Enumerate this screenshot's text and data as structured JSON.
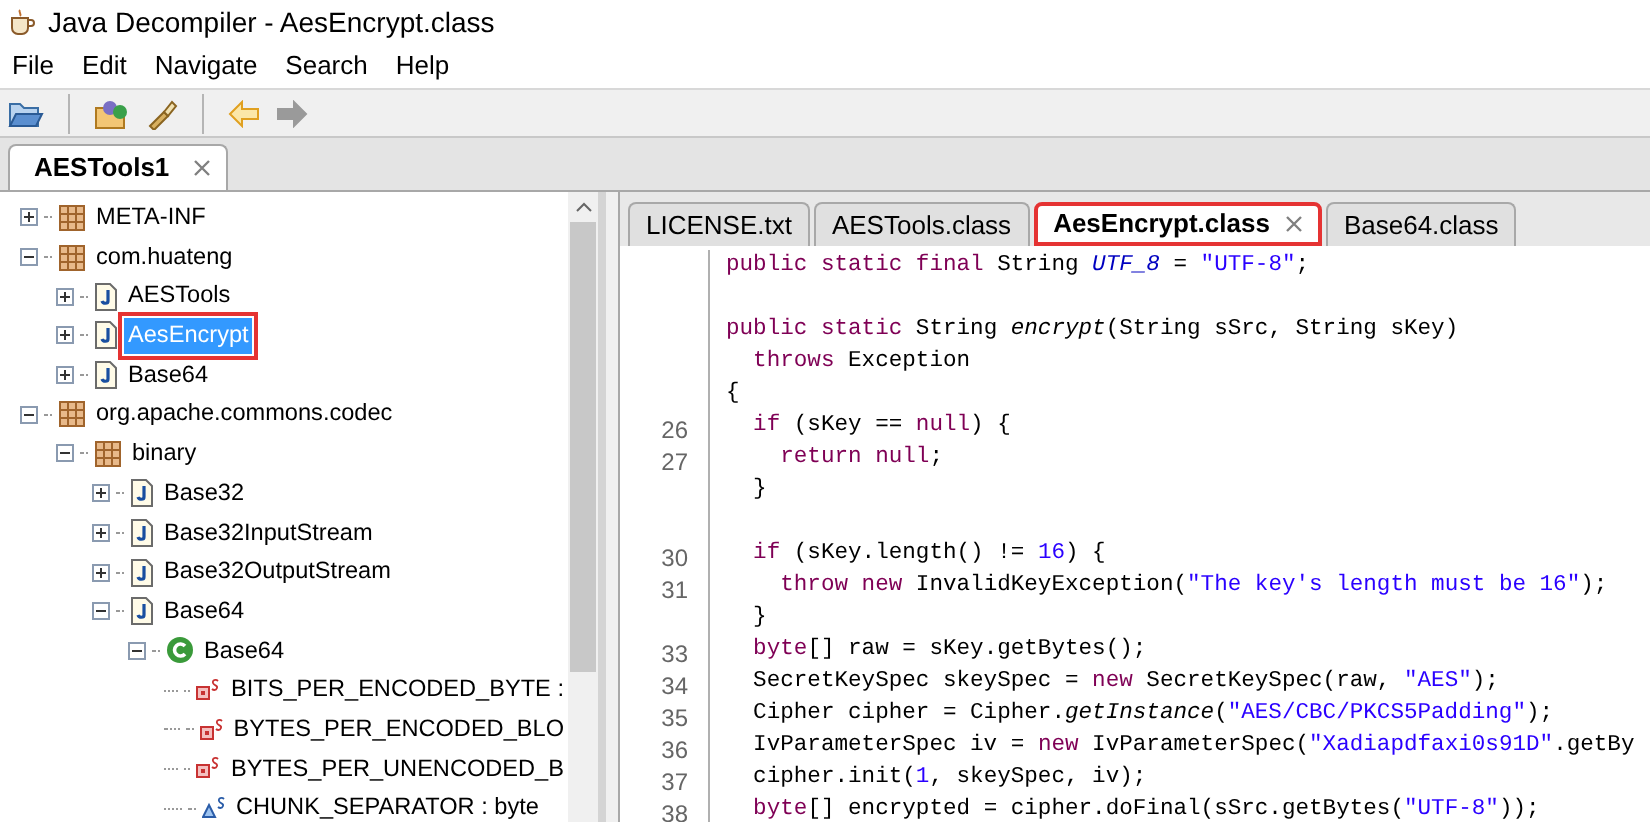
{
  "window": {
    "title": "Java Decompiler - AesEncrypt.class"
  },
  "menu": [
    "File",
    "Edit",
    "Navigate",
    "Search",
    "Help"
  ],
  "toolbar": [
    {
      "kind": "open-file",
      "disabled": false
    },
    {
      "kind": "separator"
    },
    {
      "kind": "open-type",
      "disabled": false
    },
    {
      "kind": "search",
      "disabled": false
    },
    {
      "kind": "separator"
    },
    {
      "kind": "back",
      "disabled": false
    },
    {
      "kind": "forward",
      "disabled": true
    }
  ],
  "file_tabs": [
    {
      "label": "AESTools1",
      "selected": true
    }
  ],
  "tree": [
    {
      "label": "META-INF",
      "kind": "package",
      "expanded": false,
      "selected": false
    },
    {
      "label": "com.huateng",
      "kind": "package",
      "expanded": true,
      "selected": false,
      "children": [
        {
          "label": "AESTools",
          "kind": "class-file",
          "expanded": false,
          "selected": false
        },
        {
          "label": "AesEncrypt",
          "kind": "class-file",
          "expanded": false,
          "selected": true
        },
        {
          "label": "Base64",
          "kind": "class-file",
          "expanded": false,
          "selected": false
        }
      ]
    },
    {
      "label": "org.apache.commons.codec",
      "kind": "package",
      "expanded": true,
      "selected": false,
      "children": [
        {
          "label": "binary",
          "kind": "package",
          "expanded": true,
          "selected": false,
          "children": [
            {
              "label": "Base32",
              "kind": "class-file",
              "expanded": false,
              "selected": false
            },
            {
              "label": "Base32InputStream",
              "kind": "class-file",
              "expanded": false,
              "selected": false
            },
            {
              "label": "Base32OutputStream",
              "kind": "class-file",
              "expanded": false,
              "selected": false
            },
            {
              "label": "Base64",
              "kind": "class-file",
              "expanded": true,
              "selected": false,
              "children": [
                {
                  "label": "Base64",
                  "kind": "class",
                  "expanded": true,
                  "selected": false,
                  "children": [
                    {
                      "label": "BITS_PER_ENCODED_BYTE :",
                      "kind": "private-static-field",
                      "selected": false
                    },
                    {
                      "label": "BYTES_PER_ENCODED_BLO",
                      "kind": "private-static-field",
                      "selected": false
                    },
                    {
                      "label": "BYTES_PER_UNENCODED_B",
                      "kind": "private-static-field",
                      "selected": false
                    },
                    {
                      "label": "CHUNK_SEPARATOR : byte",
                      "kind": "static-field",
                      "selected": false
                    }
                  ]
                }
              ]
            }
          ]
        }
      ]
    }
  ],
  "editor_tabs": [
    {
      "label": "LICENSE.txt",
      "selected": false
    },
    {
      "label": "AESTools.class",
      "selected": false
    },
    {
      "label": "AesEncrypt.class",
      "selected": true
    },
    {
      "label": "Base64.class",
      "selected": false
    }
  ],
  "code": [
    {
      "kind": "code",
      "tokens": [
        {
          "kind": "keyword",
          "text": "public static final"
        },
        {
          "kind": "plain",
          "text": " String "
        },
        {
          "kind": "field",
          "text": "UTF_8"
        },
        {
          "kind": "plain",
          "text": " = "
        },
        {
          "kind": "string",
          "text": "\"UTF-8\""
        },
        {
          "kind": "plain",
          "text": ";"
        }
      ]
    },
    {
      "kind": "blank"
    },
    {
      "kind": "code",
      "tokens": [
        {
          "kind": "keyword",
          "text": "public static"
        },
        {
          "kind": "plain",
          "text": " String "
        },
        {
          "kind": "method",
          "text": "encrypt"
        },
        {
          "kind": "plain",
          "text": "(String sSrc, String sKey)"
        }
      ]
    },
    {
      "kind": "code",
      "tokens": [
        {
          "kind": "keyword",
          "text": "  throws"
        },
        {
          "kind": "plain",
          "text": " Exception"
        }
      ]
    },
    {
      "kind": "code",
      "tokens": [
        {
          "kind": "plain",
          "text": "{"
        }
      ]
    },
    {
      "kind": "code",
      "number": "26",
      "tokens": [
        {
          "kind": "keyword",
          "text": "  if"
        },
        {
          "kind": "plain",
          "text": " (sKey == "
        },
        {
          "kind": "keyword",
          "text": "null"
        },
        {
          "kind": "plain",
          "text": ") {"
        }
      ]
    },
    {
      "kind": "code",
      "number": "27",
      "tokens": [
        {
          "kind": "keyword",
          "text": "    return null"
        },
        {
          "kind": "plain",
          "text": ";"
        }
      ]
    },
    {
      "kind": "code",
      "tokens": [
        {
          "kind": "plain",
          "text": "  }"
        }
      ]
    },
    {
      "kind": "blank"
    },
    {
      "kind": "code",
      "number": "30",
      "tokens": [
        {
          "kind": "keyword",
          "text": "  if"
        },
        {
          "kind": "plain",
          "text": " (sKey.length() != "
        },
        {
          "kind": "number",
          "text": "16"
        },
        {
          "kind": "plain",
          "text": ") {"
        }
      ]
    },
    {
      "kind": "code",
      "number": "31",
      "tokens": [
        {
          "kind": "keyword",
          "text": "    throw new"
        },
        {
          "kind": "plain",
          "text": " InvalidKeyException("
        },
        {
          "kind": "string",
          "text": "\"The key's length must be 16\""
        },
        {
          "kind": "plain",
          "text": ");"
        }
      ]
    },
    {
      "kind": "code",
      "tokens": [
        {
          "kind": "plain",
          "text": "  }"
        }
      ]
    },
    {
      "kind": "code",
      "number": "33",
      "tokens": [
        {
          "kind": "keyword",
          "text": "  byte"
        },
        {
          "kind": "plain",
          "text": "[] raw = sKey.getBytes();"
        }
      ]
    },
    {
      "kind": "code",
      "number": "34",
      "tokens": [
        {
          "kind": "plain",
          "text": "  SecretKeySpec skeySpec = "
        },
        {
          "kind": "keyword",
          "text": "new"
        },
        {
          "kind": "plain",
          "text": " SecretKeySpec(raw, "
        },
        {
          "kind": "string",
          "text": "\"AES\""
        },
        {
          "kind": "plain",
          "text": ");"
        }
      ]
    },
    {
      "kind": "code",
      "number": "35",
      "tokens": [
        {
          "kind": "plain",
          "text": "  Cipher cipher = Cipher."
        },
        {
          "kind": "method",
          "text": "getInstance"
        },
        {
          "kind": "plain",
          "text": "("
        },
        {
          "kind": "string",
          "text": "\"AES/CBC/PKCS5Padding\""
        },
        {
          "kind": "plain",
          "text": ");"
        }
      ]
    },
    {
      "kind": "code",
      "number": "36",
      "tokens": [
        {
          "kind": "plain",
          "text": "  IvParameterSpec iv = "
        },
        {
          "kind": "keyword",
          "text": "new"
        },
        {
          "kind": "plain",
          "text": " IvParameterSpec("
        },
        {
          "kind": "string",
          "text": "\"Xadiapdfaxi0s91D\""
        },
        {
          "kind": "plain",
          "text": ".getBy"
        }
      ]
    },
    {
      "kind": "code",
      "number": "37",
      "tokens": [
        {
          "kind": "plain",
          "text": "  cipher.init("
        },
        {
          "kind": "number",
          "text": "1"
        },
        {
          "kind": "plain",
          "text": ", skeySpec, iv);"
        }
      ]
    },
    {
      "kind": "code",
      "number": "38",
      "tokens": [
        {
          "kind": "keyword",
          "text": "  byte"
        },
        {
          "kind": "plain",
          "text": "[] encrypted = cipher.doFinal(sSrc.getBytes("
        },
        {
          "kind": "string",
          "text": "\"UTF-8\""
        },
        {
          "kind": "plain",
          "text": "));"
        }
      ]
    }
  ]
}
